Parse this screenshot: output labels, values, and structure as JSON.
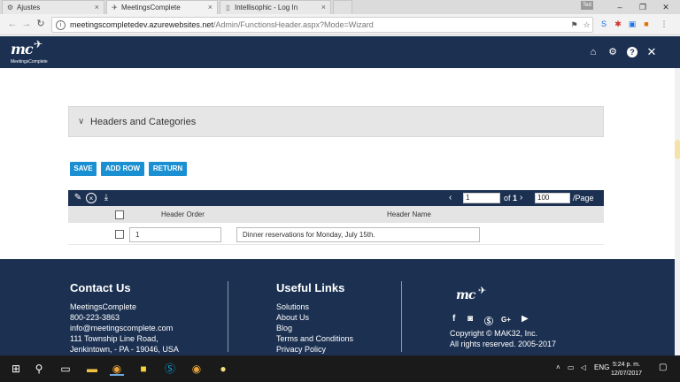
{
  "browser": {
    "tabs": [
      {
        "label": "Ajustes",
        "icon": "gear-icon"
      },
      {
        "label": "MeetingsComplete",
        "icon": "plane-icon"
      },
      {
        "label": "Intellisophic - Log In",
        "icon": "page-icon"
      }
    ],
    "user_badge": "Ted",
    "url_domain": "meetingscompletedev.azurewebsites.net",
    "url_path": "/Admin/FunctionsHeader.aspx?Mode=Wizard"
  },
  "app": {
    "logo_text": "mc",
    "logo_subtitle": "MeetingsComplete"
  },
  "accordion": {
    "title": "Headers and Categories"
  },
  "actions": {
    "save": "SAVE",
    "add_row": "ADD ROW",
    "return": "RETURN"
  },
  "pager": {
    "current_page": "1",
    "of_label": "of",
    "total_pages": "1",
    "page_size": "100",
    "per_page_label": "/Page"
  },
  "grid": {
    "columns": [
      "Header Order",
      "Header Name"
    ],
    "rows": [
      {
        "order": "1",
        "name": "Dinner reservations for Monday, July 15th."
      }
    ]
  },
  "footer": {
    "contact": {
      "title": "Contact Us",
      "lines": [
        "MeetingsComplete",
        "800-223-3863",
        "info@meetingscomplete.com",
        "111 Township Line Road,",
        "Jenkintown, - PA - 19046, USA"
      ]
    },
    "links": {
      "title": "Useful Links",
      "items": [
        "Solutions",
        "About Us",
        "Blog",
        "Terms and Conditions",
        "Privacy Policy"
      ]
    },
    "brand": {
      "logo_text": "mc",
      "social": [
        "f",
        "G+"
      ],
      "copyright": "Copyright © MAK32, Inc.",
      "rights": "All rights reserved. 2005-2017"
    }
  },
  "taskbar": {
    "language": "ENG",
    "time": "5:24 p. m.",
    "date": "12/07/2017"
  },
  "colors": {
    "navy": "#1c3152",
    "button_blue": "#1a8fd1"
  }
}
